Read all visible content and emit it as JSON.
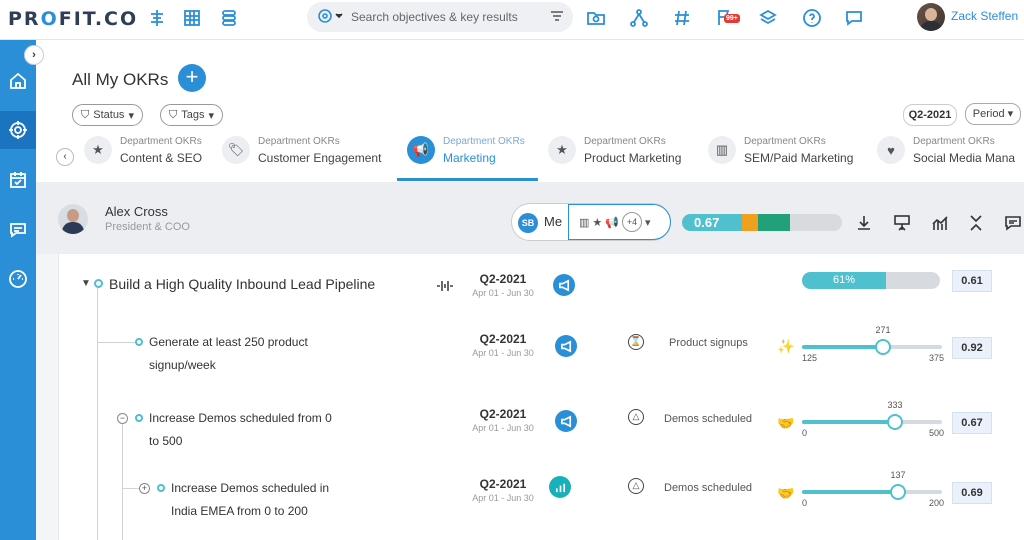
{
  "app": {
    "logo_pre": "PR",
    "logo_dot": "O",
    "logo_post": "FIT.CO"
  },
  "search": {
    "placeholder": "Search objectives & key results"
  },
  "notifications": {
    "badge": "99+"
  },
  "user": {
    "name": "Zack Steffen"
  },
  "sidebar": {
    "toggle": "›"
  },
  "page": {
    "title": "All My OKRs",
    "add": "+"
  },
  "filters": {
    "status_label": "Status",
    "tags_label": "Tags",
    "quarter": "Q2-2021",
    "period_label": "Period"
  },
  "tabs": {
    "scroll_left": "‹",
    "items": [
      {
        "sub": "Department OKRs",
        "name": "Content & SEO",
        "icon": "★"
      },
      {
        "sub": "Department OKRs",
        "name": "Customer Engagement",
        "icon": "🏷"
      },
      {
        "sub": "Department OKRs",
        "name": "Marketing",
        "icon": "📢"
      },
      {
        "sub": "Department OKRs",
        "name": "Product Marketing",
        "icon": "★"
      },
      {
        "sub": "Department OKRs",
        "name": "SEM/Paid Marketing",
        "icon": "▥"
      },
      {
        "sub": "Department OKRs",
        "name": "Social Media Mana",
        "icon": "♥"
      }
    ]
  },
  "owner": {
    "name": "Alex Cross",
    "role": "President & COO",
    "initials": "SB",
    "me_label": "Me",
    "more_count": "+4",
    "overall_score": "0.67"
  },
  "objective": {
    "title": "Build a High Quality Inbound Lead Pipeline",
    "quarter": "Q2-2021",
    "dates": "Apr 01 - Jun 30",
    "progress_label": "61%",
    "progress": 61,
    "score": "0.61"
  },
  "key_results": [
    {
      "line1": "Generate at least 250 product",
      "line2": "signup/week",
      "quarter": "Q2-2021",
      "dates": "Apr 01 - Jun 30",
      "indicator": "Product signups",
      "min": "125",
      "max": "375",
      "current": "271",
      "fraction": 0.58,
      "score": "0.92"
    },
    {
      "line1": "Increase Demos scheduled from 0",
      "line2": "to 500",
      "quarter": "Q2-2021",
      "dates": "Apr 01 - Jun 30",
      "indicator": "Demos scheduled",
      "min": "0",
      "max": "500",
      "current": "333",
      "fraction": 0.666,
      "score": "0.67",
      "toggle": "−"
    },
    {
      "line1": "Increase Demos scheduled in",
      "line2": "India EMEA from 0 to 200",
      "quarter": "Q2-2021",
      "dates": "Apr 01 - Jun 30",
      "indicator": "Demos scheduled",
      "min": "0",
      "max": "200",
      "current": "137",
      "fraction": 0.685,
      "score": "0.69",
      "toggle": "+"
    }
  ]
}
